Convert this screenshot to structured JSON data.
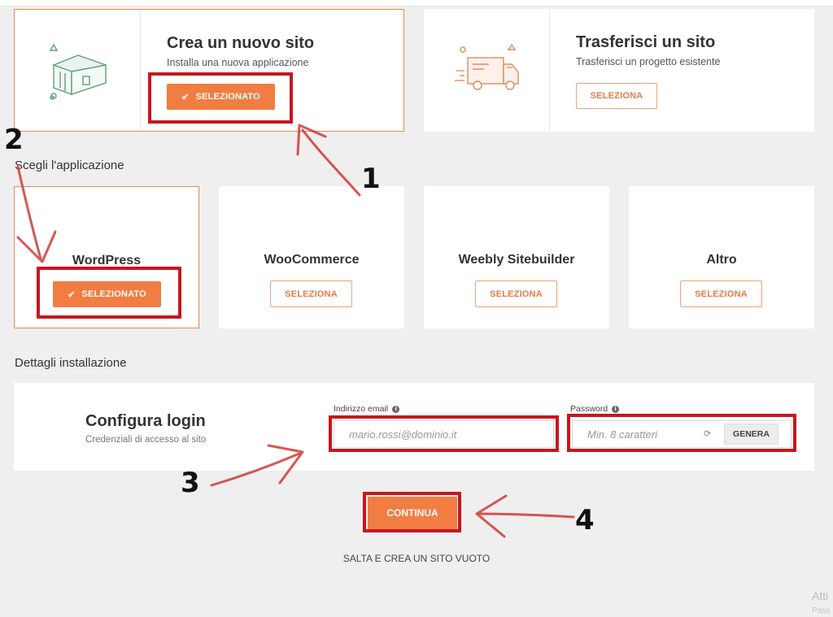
{
  "site_options": [
    {
      "title": "Crea un nuovo sito",
      "subtitle": "Installa una nuova applicazione",
      "button": "SELEZIONATO",
      "selected": true,
      "icon": "house-icon"
    },
    {
      "title": "Trasferisci un sito",
      "subtitle": "Trasferisci un progetto esistente",
      "button": "SELEZIONA",
      "selected": false,
      "icon": "truck-icon"
    }
  ],
  "app_section": {
    "label": "Scegli l'applicazione",
    "apps": [
      {
        "name": "WordPress",
        "button": "SELEZIONATO",
        "selected": true
      },
      {
        "name": "WooCommerce",
        "button": "SELEZIONA",
        "selected": false
      },
      {
        "name": "Weebly Sitebuilder",
        "button": "SELEZIONA",
        "selected": false
      },
      {
        "name": "Altro",
        "button": "SELEZIONA",
        "selected": false
      }
    ]
  },
  "install_section": {
    "label": "Dettagli installazione",
    "title": "Configura login",
    "subtitle": "Credenziali di accesso al sito",
    "email": {
      "label": "Indirizzo email",
      "placeholder": "mario.rossi@dominio.it"
    },
    "password": {
      "label": "Password",
      "placeholder": "Min. 8 caratteri",
      "generate_label": "GENERA"
    }
  },
  "continue_label": "CONTINUA",
  "skip_label": "SALTA E CREA UN SITO VUOTO",
  "annotations": {
    "n1": "1",
    "n2": "2",
    "n3": "3",
    "n4": "4"
  },
  "watermark": {
    "line1": "Atti",
    "line2": "Pass"
  },
  "colors": {
    "accent": "#f27d42",
    "annotation_red": "#c8161d",
    "background": "#efefef"
  }
}
